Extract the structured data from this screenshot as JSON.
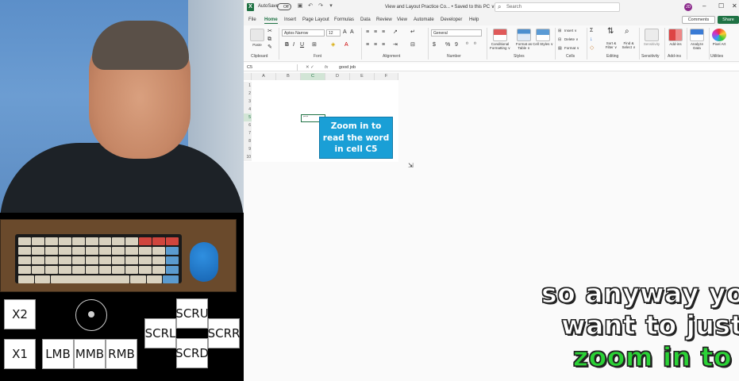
{
  "excel": {
    "title_bar": {
      "autosave_label": "AutoSave",
      "autosave_state": "Off",
      "document_title": "View and Layout Practice Co... • Saved to this PC ∨",
      "search_placeholder": "Search",
      "user_initials": "JD",
      "minimize": "–",
      "maximize": "☐",
      "close": "✕"
    },
    "menu": {
      "tabs": [
        "File",
        "Home",
        "Insert",
        "Page Layout",
        "Formulas",
        "Data",
        "Review",
        "View",
        "Automate",
        "Developer",
        "Help"
      ],
      "active_tab": "Home",
      "comments_label": "Comments",
      "share_label": "Share"
    },
    "ribbon": {
      "font_name": "Aptos Narrow",
      "font_size": "12",
      "number_format": "General",
      "groups": {
        "clipboard": "Clipboard",
        "font": "Font",
        "alignment": "Alignment",
        "number": "Number",
        "styles": "Styles",
        "cells": "Cells",
        "editing": "Editing",
        "sensitivity": "Sensitivity",
        "addins": "Add-ins",
        "utilities": "Utilities"
      },
      "buttons": {
        "paste": "Paste",
        "conditional_formatting": "Conditional Formatting ∨",
        "format_as_table": "Format as Table ∨",
        "cell_styles": "Cell Styles ∨",
        "insert": "Insert ∨",
        "delete": "Delete ∨",
        "format": "Format ∨",
        "sort_filter": "Sort & Filter ∨",
        "find_select": "Find & Select ∨",
        "sensitivity": "Sensitivity",
        "addins": "Add-ins",
        "analyze_data": "Analyze Data",
        "pixel_art": "Pixel Art"
      }
    },
    "formula_bar": {
      "name_box": "C5",
      "fx": "fx",
      "value": "good job"
    },
    "grid": {
      "columns": [
        "A",
        "B",
        "C",
        "D",
        "E",
        "F"
      ],
      "selected_column": "C",
      "rows": [
        "1",
        "2",
        "3",
        "4",
        "5",
        "6",
        "7",
        "8",
        "9",
        "10"
      ],
      "selected_row": "5",
      "cell_c5_value": "good job"
    },
    "callout_text": "Zoom in to read the word in cell C5"
  },
  "overlay": {
    "mouse_buttons": [
      "X2",
      "X1",
      "LMB",
      "MMB",
      "RMB",
      "SCRU",
      "SCRL",
      "SCRR",
      "SCRD"
    ]
  },
  "captions": {
    "line1": "so anyway you",
    "line2": "want to just",
    "line3": "zoom in to"
  },
  "colors": {
    "excel_green": "#1f7244",
    "callout_blue": "#1a9fd6",
    "caption_highlight": "#2bd236"
  }
}
